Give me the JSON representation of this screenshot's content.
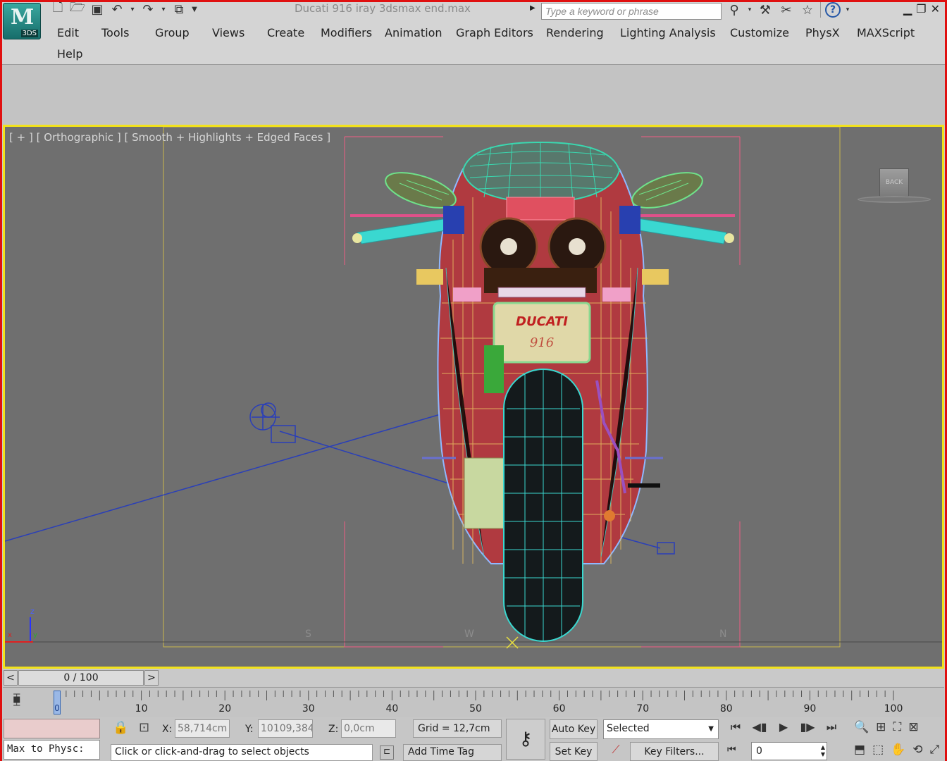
{
  "app": {
    "logo_letter": "M",
    "logo_sub": "3DS",
    "document_title": "Ducati 916 iray 3dsmax end.max",
    "search_placeholder": "Type a keyword or phrase"
  },
  "quick_access_icons": [
    "new-file-icon",
    "open-file-icon",
    "save-icon",
    "undo-icon",
    "redo-icon",
    "project-folder-icon"
  ],
  "menu": {
    "row1": [
      "Edit",
      "Tools",
      "Group",
      "Views",
      "Create",
      "Modifiers",
      "Animation",
      "Graph Editors",
      "Rendering",
      "Lighting Analysis",
      "Customize",
      "PhysX",
      "MAXScript"
    ],
    "row2": [
      "Help"
    ]
  },
  "viewport": {
    "label": "[ + ] [ Orthographic ] [ Smooth + Highlights + Edged Faces ]",
    "viewcube_label": "BACK",
    "compass": [
      "S",
      "W",
      "N"
    ],
    "axis": {
      "z": "z",
      "x": "x",
      "y": "y"
    },
    "plate_text_top": "DUCATI",
    "plate_text_bottom": "916"
  },
  "time_slider": {
    "left": "<",
    "right": ">",
    "label": "0 / 100"
  },
  "track_bar": {
    "ticks": [
      "10",
      "20",
      "30",
      "40",
      "50",
      "60",
      "70",
      "80",
      "90",
      "100"
    ],
    "current_frame": "0"
  },
  "status": {
    "maxscript_text": "Max to Physc:",
    "x_label": "X:",
    "x_value": "58,714cm",
    "y_label": "Y:",
    "y_value": "10109,384",
    "z_label": "Z:",
    "z_value": "0,0cm",
    "grid": "Grid = 12,7cm",
    "prompt": "Click or click-and-drag to select objects",
    "add_time_tag": "Add Time Tag",
    "auto_key": "Auto Key",
    "set_key": "Set Key",
    "selection_set": "Selected",
    "key_filters": "Key Filters...",
    "frame_value": "0"
  },
  "colors": {
    "viewport_bg": "#6f6f6f",
    "active_border": "#f2e21a",
    "window_frame": "#e01010",
    "wire_red": "#e03040",
    "wire_cyan": "#3ad8d0",
    "wire_green": "#6fe28a"
  }
}
